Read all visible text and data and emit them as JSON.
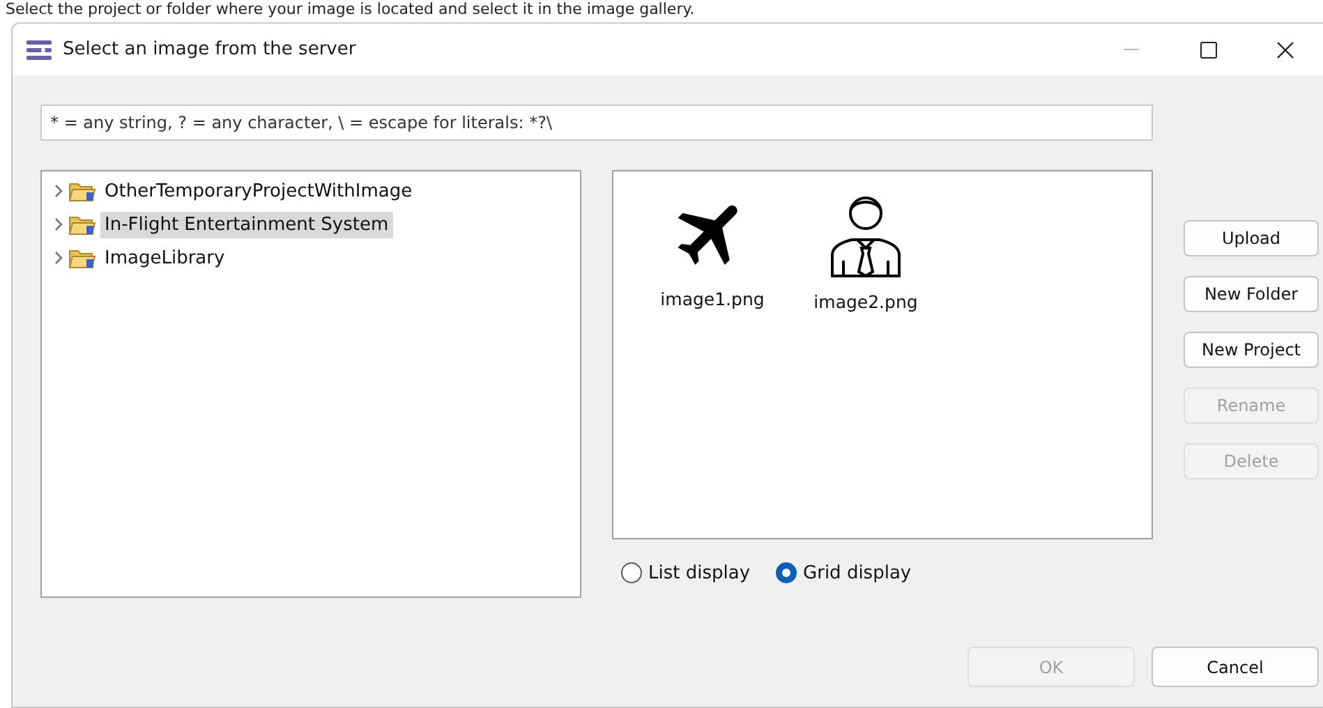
{
  "instruction": "Select the project or folder where your image is located and select it in the image gallery.",
  "window": {
    "title": "Select an image from the server",
    "controls": [
      {
        "kind": "minimize",
        "disabled": true
      },
      {
        "kind": "maximize",
        "disabled": false
      },
      {
        "kind": "close",
        "disabled": false
      }
    ]
  },
  "filter": {
    "value": "* = any string, ? = any character, \\ = escape for literals: *?\\"
  },
  "tree": {
    "items": [
      {
        "label": "OtherTemporaryProjectWithImage",
        "selected": false
      },
      {
        "label": "In-Flight Entertainment System",
        "selected": true
      },
      {
        "label": "ImageLibrary",
        "selected": false
      }
    ]
  },
  "gallery": {
    "items": [
      {
        "kind": "airplane",
        "label": "image1.png"
      },
      {
        "kind": "person",
        "label": "image2.png"
      }
    ]
  },
  "side_buttons": [
    {
      "label": "Upload",
      "disabled": false
    },
    {
      "label": "New Folder",
      "disabled": false
    },
    {
      "label": "New Project",
      "disabled": false
    },
    {
      "label": "Rename",
      "disabled": true
    },
    {
      "label": "Delete",
      "disabled": true
    }
  ],
  "display_options": [
    {
      "label": "List display",
      "selected": false
    },
    {
      "label": "Grid display",
      "selected": true
    }
  ],
  "footer_buttons": [
    {
      "label": "OK",
      "disabled": true
    },
    {
      "label": "Cancel",
      "disabled": false
    }
  ]
}
